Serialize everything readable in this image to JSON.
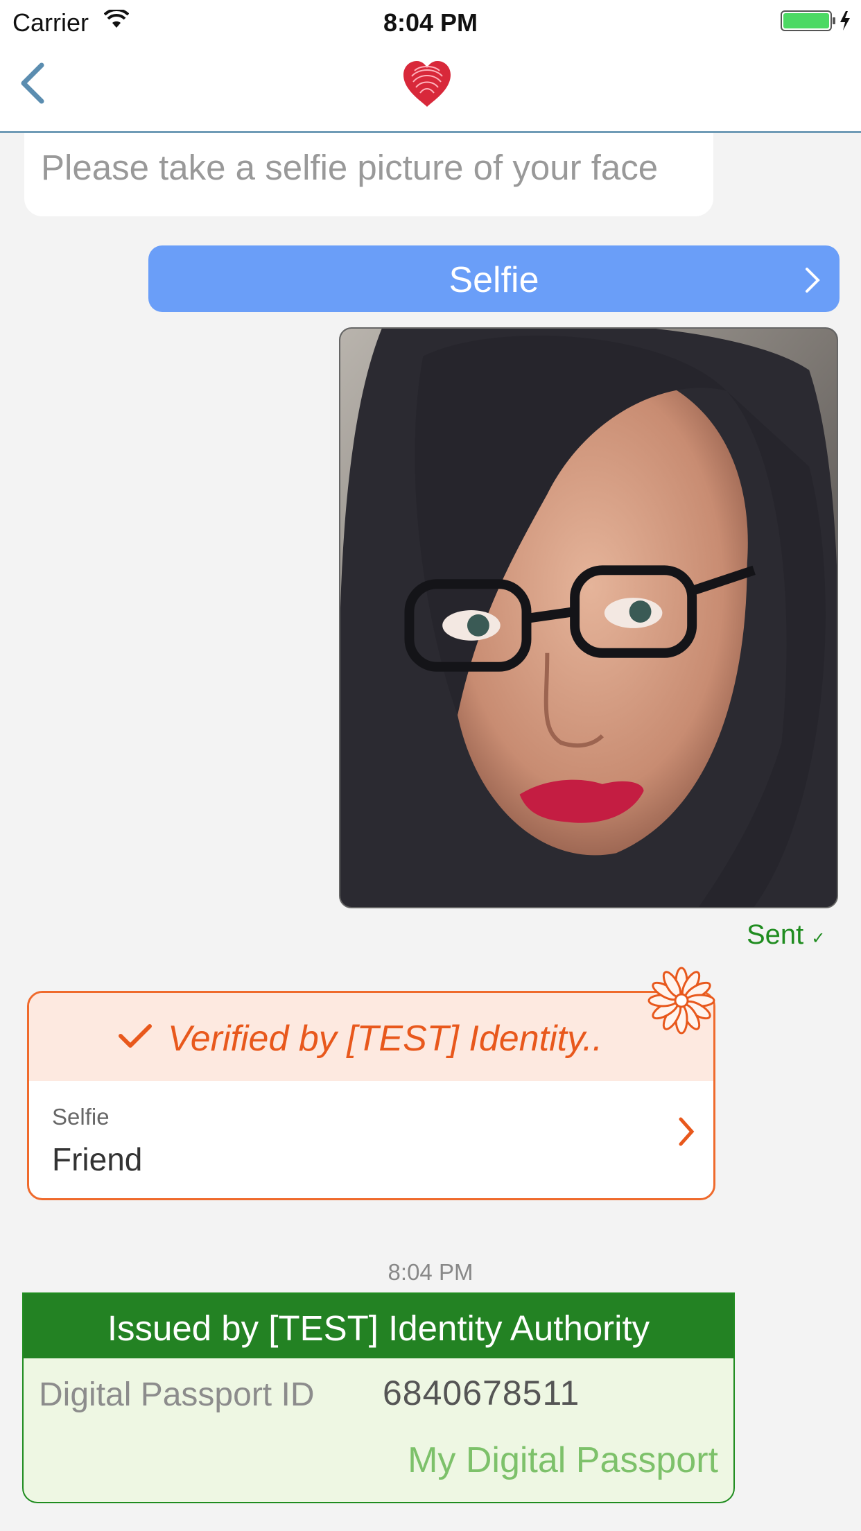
{
  "status_bar": {
    "carrier": "Carrier",
    "time": "8:04 PM"
  },
  "nav": {
    "back_icon": "chevron-left-icon",
    "logo_icon": "fingerprint-heart-icon"
  },
  "chat": {
    "prompt": "Please take a selfie picture of your face",
    "selfie_button_label": "Selfie",
    "sent_label": "Sent",
    "sent_check": "✓"
  },
  "verification_card": {
    "title": "Verified by [TEST] Identity..",
    "field_label": "Selfie",
    "field_value": "Friend",
    "badge_icon": "flower-badge-icon",
    "accent_color": "#ef6a2c"
  },
  "timestamp": "8:04 PM",
  "passport_card": {
    "header": "Issued by [TEST] Identity Authority",
    "id_label": "Digital Passport ID",
    "id_value": "6840678511",
    "link_label": "My Digital Passport",
    "header_color": "#238223"
  },
  "colors": {
    "selfie_button": "#6a9ef8",
    "sent_status": "#1f8c1f",
    "nav_accent": "#6f9bb6"
  }
}
